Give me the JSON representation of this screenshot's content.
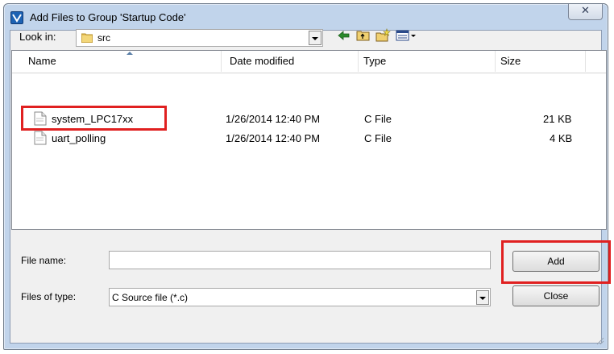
{
  "window": {
    "title": "Add Files to Group 'Startup Code'",
    "close_glyph": "✕"
  },
  "toolbar": {
    "look_in_label": "Look in:",
    "look_in_value": "src",
    "icons": [
      "back-arrow-icon",
      "up-folder-icon",
      "new-folder-icon",
      "view-menu-icon"
    ]
  },
  "filelist": {
    "columns": [
      "Name",
      "Date modified",
      "Type",
      "Size"
    ],
    "rows": [
      {
        "name": "system_LPC17xx",
        "date": "1/26/2014 12:40 PM",
        "type": "C File",
        "size": "21 KB"
      },
      {
        "name": "uart_polling",
        "date": "1/26/2014 12:40 PM",
        "type": "C File",
        "size": "4 KB"
      }
    ]
  },
  "form": {
    "file_name_label": "File name:",
    "file_name_value": "",
    "file_type_label": "Files of type:",
    "file_type_value": "C Source file (*.c)",
    "add_label": "Add",
    "close_label": "Close"
  },
  "colors": {
    "highlight": "#e02020",
    "titlebar": "#c1d4eb"
  }
}
